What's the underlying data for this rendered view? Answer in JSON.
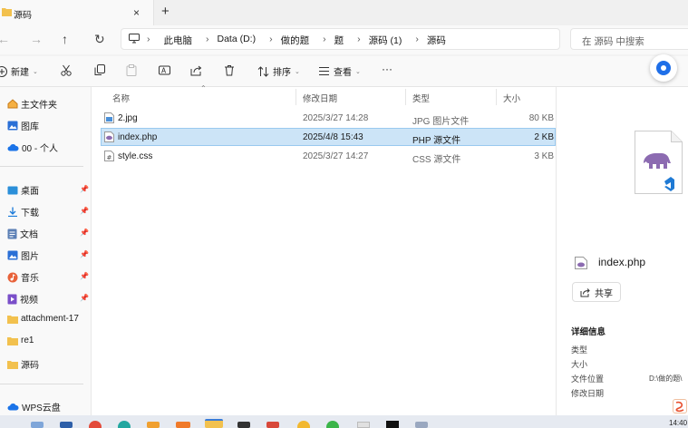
{
  "tab": {
    "title": "源码",
    "close": "×",
    "new": "+"
  },
  "nav": {
    "back": "←",
    "forward": "→",
    "up": "↑",
    "refresh": "↻"
  },
  "breadcrumbs": [
    "此电脑",
    "Data (D:)",
    "做的题",
    "题",
    "源码 (1)",
    "源码"
  ],
  "crumb_sep": "›",
  "search": {
    "placeholder": "在 源码 中搜索"
  },
  "toolbar": {
    "new": "新建",
    "sort": "排序",
    "view": "查看",
    "more": "···"
  },
  "sidebar": {
    "items": [
      {
        "label": "主文件夹",
        "icon": "home-icon"
      },
      {
        "label": "图库",
        "icon": "gallery-icon"
      },
      {
        "label": "00 - 个人",
        "icon": "cloud-icon"
      },
      {
        "label": "桌面",
        "icon": "desktop-icon",
        "pinned": true
      },
      {
        "label": "下载",
        "icon": "download-icon",
        "pinned": true
      },
      {
        "label": "文档",
        "icon": "document-icon",
        "pinned": true
      },
      {
        "label": "图片",
        "icon": "picture-icon",
        "pinned": true
      },
      {
        "label": "音乐",
        "icon": "music-icon",
        "pinned": true
      },
      {
        "label": "视频",
        "icon": "video-icon",
        "pinned": true
      },
      {
        "label": "attachment-17",
        "icon": "folder-icon"
      },
      {
        "label": "re1",
        "icon": "folder-icon"
      },
      {
        "label": "源码",
        "icon": "folder-icon"
      },
      {
        "label": "WPS云盘",
        "icon": "cloud-icon"
      }
    ]
  },
  "columns": {
    "name": "名称",
    "date": "修改日期",
    "type": "类型",
    "size": "大小"
  },
  "files": [
    {
      "name": "2.jpg",
      "date": "2025/3/27 14:28",
      "type": "JPG 图片文件",
      "size": "80 KB",
      "selected": false
    },
    {
      "name": "index.php",
      "date": "2025/4/8 15:43",
      "type": "PHP 源文件",
      "size": "2 KB",
      "selected": true
    },
    {
      "name": "style.css",
      "date": "2025/3/27 14:27",
      "type": "CSS 源文件",
      "size": "3 KB",
      "selected": false
    }
  ],
  "preview": {
    "filename": "index.php",
    "share": "共享",
    "details_title": "详细信息",
    "labels": [
      "类型",
      "大小",
      "文件位置",
      "修改日期"
    ],
    "location": "D:\\做的题\\"
  },
  "taskbar": {
    "clock": "14:40"
  },
  "colors": {
    "accent": "#1f6fe8",
    "selection": "#cce4f7",
    "selection_border": "#99c9ef",
    "folder": "#f2c14e",
    "php": "#8c6bb1"
  }
}
